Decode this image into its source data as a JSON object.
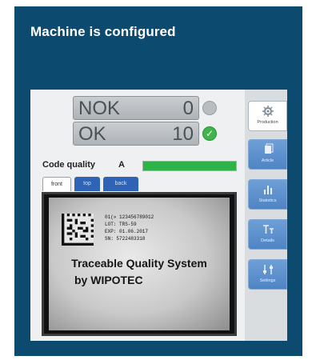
{
  "header": {
    "title": "Machine is configured"
  },
  "counters": [
    {
      "label": "NOK",
      "value": "0",
      "status": "neutral"
    },
    {
      "label": "OK",
      "value": "10",
      "status": "ok"
    }
  ],
  "quality": {
    "label": "Code quality",
    "grade": "A",
    "level_percent": 100,
    "bar_color": "#2fb24a"
  },
  "view_tabs": [
    {
      "label": "front",
      "active": true
    },
    {
      "label": "top",
      "active": false
    },
    {
      "label": "back",
      "active": false
    }
  ],
  "camera": {
    "code_lines": [
      "01(» 123456789012",
      "LOT: TRS-59",
      "EXP: 01.06.2017",
      "SN: 5722483318"
    ],
    "print_line1": "Traceable Quality System",
    "print_line2": "by WIPOTEC"
  },
  "sidebar": [
    {
      "label": "Production",
      "icon": "gear-icon",
      "active": true
    },
    {
      "label": "Article",
      "icon": "article-icon",
      "active": false
    },
    {
      "label": "Statistics",
      "icon": "bar-chart-icon",
      "active": false
    },
    {
      "label": "Details",
      "icon": "details-icon",
      "active": false
    },
    {
      "label": "Settings",
      "icon": "settings-icon",
      "active": false
    }
  ],
  "colors": {
    "card_bg": "#0d4a70",
    "accent_blue": "#4f84c4",
    "ok_green": "#3fb54a"
  }
}
